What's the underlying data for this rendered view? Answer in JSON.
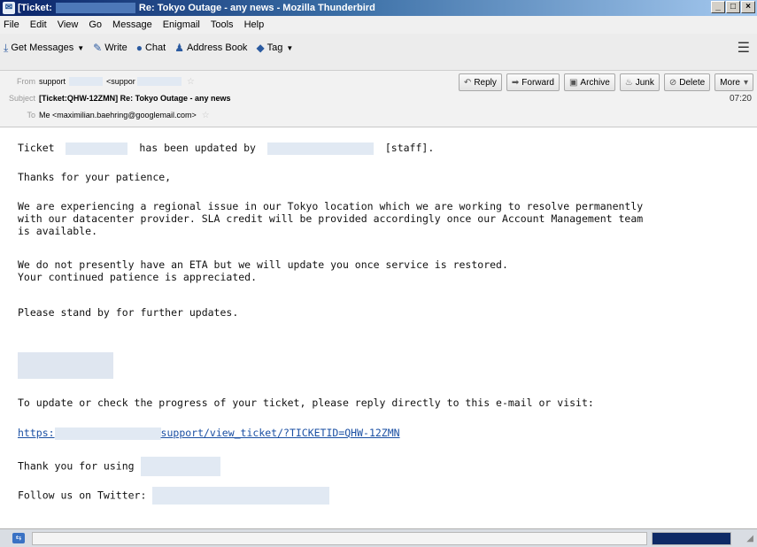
{
  "window": {
    "title_prefix": "[Ticket:",
    "title_rest": "Re: Tokyo Outage - any news - Mozilla Thunderbird"
  },
  "menu": [
    "File",
    "Edit",
    "View",
    "Go",
    "Message",
    "Enigmail",
    "Tools",
    "Help"
  ],
  "toolbar": {
    "get_messages": "Get Messages",
    "write": "Write",
    "chat": "Chat",
    "address_book": "Address Book",
    "tag": "Tag"
  },
  "header": {
    "from_label": "From",
    "from_name": "support",
    "from_email": "<suppor",
    "subject_label": "Subject",
    "subject": "[Ticket:QHW-12ZMN] Re: Tokyo Outage - any news",
    "to_label": "To",
    "to_value": "Me <maximilian.baehring@googlemail.com>",
    "time": "07:20",
    "actions": {
      "reply": "Reply",
      "forward": "Forward",
      "archive": "Archive",
      "junk": "Junk",
      "delete": "Delete",
      "more": "More"
    }
  },
  "message": {
    "line1_a": "Ticket",
    "line1_b": "has been updated by",
    "line1_c": "[staff].",
    "thanks": "Thanks for your patience,",
    "p1_l1": "We are experiencing a regional issue in our Tokyo location which we are working to resolve permanently",
    "p1_l2": "with our datacenter provider. SLA credit will be provided accordingly once our Account Management team",
    "p1_l3": "is available.",
    "p2_l1": "We do not presently have an ETA but we will update you once service is restored.",
    "p2_l2": "Your continued patience is appreciated.",
    "standby": "Please stand by for further updates.",
    "update_info": "To update or check the progress of your ticket, please reply directly to this e-mail or visit:",
    "link_a": "https:",
    "link_b": "support/view_ticket/?TICKETID=QHW-12ZMN",
    "thank_you": "Thank you for using",
    "follow": "Follow us on Twitter:"
  }
}
